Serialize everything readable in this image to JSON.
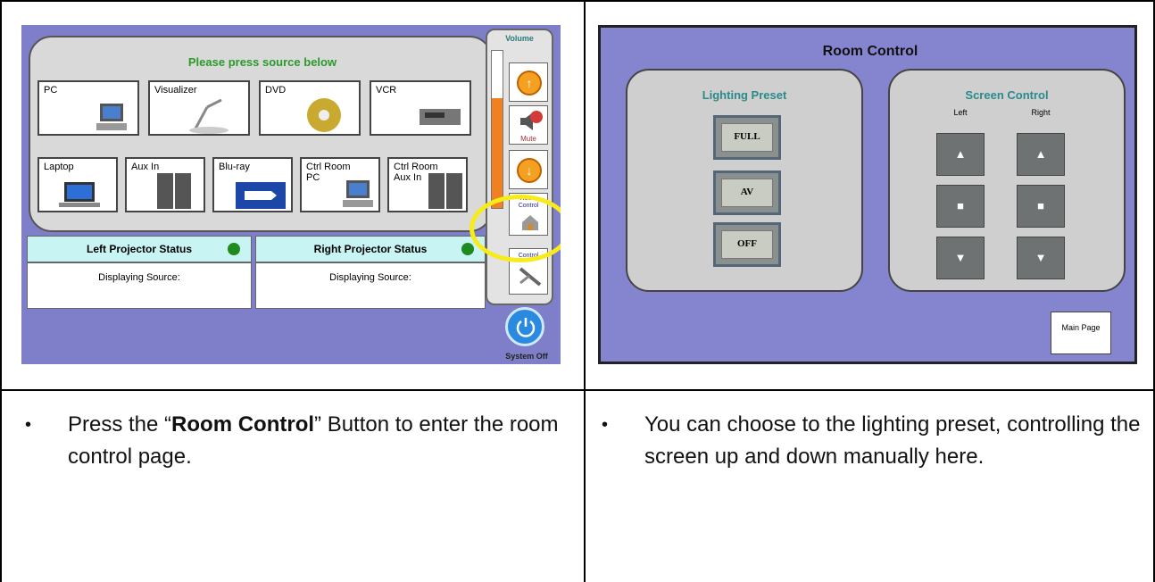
{
  "left_screen": {
    "prompt": "Please press source below",
    "sources": [
      "PC",
      "Visualizer",
      "DVD",
      "VCR",
      "Laptop",
      "Aux In",
      "Blu-ray",
      "Ctrl Room PC",
      "Ctrl Room Aux In"
    ],
    "left_status_title": "Left Projector Status",
    "right_status_title": "Right Projector Status",
    "displaying": "Displaying Source:",
    "volume_label": "Volume",
    "mute_label": "Mute",
    "room_control_label": "Room Control",
    "control_label": "Control",
    "system_off_label": "System Off"
  },
  "right_screen": {
    "title": "Room Control",
    "lighting_title": "Lighting Preset",
    "lighting_buttons": [
      "FULL",
      "AV",
      "OFF"
    ],
    "screen_title": "Screen Control",
    "left_label": "Left",
    "right_label": "Right",
    "up_glyph": "▲",
    "stop_glyph": "■",
    "down_glyph": "▼",
    "main_page_label": "Main Page"
  },
  "captions": {
    "bullet": "•",
    "left_pre": "Press the “",
    "left_bold": "Room Control",
    "left_post": "” Button to enter the room control page.",
    "right": "You can choose to the lighting preset, controlling the screen up and down manually here."
  }
}
